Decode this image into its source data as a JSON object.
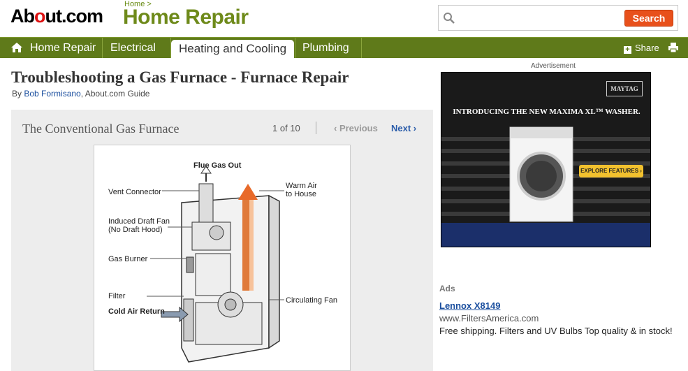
{
  "header": {
    "logo_prefix": "Ab",
    "logo_dot": "o",
    "logo_suffix": "ut.com",
    "breadcrumb": "Home",
    "breadcrumb_sep": ">",
    "site_title": "Home Repair",
    "search_placeholder": "",
    "search_button": "Search"
  },
  "nav": {
    "items": [
      {
        "label": "Home Repair",
        "icon": "house-icon"
      },
      {
        "label": "Electrical"
      },
      {
        "label": "Heating and Cooling",
        "active": true
      },
      {
        "label": "Plumbing"
      }
    ],
    "share_label": "Share",
    "print_icon": "printer-icon"
  },
  "article": {
    "title": "Troubleshooting a Gas Furnace - Furnace Repair",
    "by": "By",
    "author": "Bob Formisano",
    "author_suffix": ", About.com Guide"
  },
  "slideshow": {
    "title": "The Conventional Gas Furnace",
    "count": "1 of 10",
    "prev": "‹ Previous",
    "next": "Next ›"
  },
  "diagram": {
    "labels": {
      "flue": "Flue Gas Out",
      "vent": "Vent Connector",
      "warm_air_1": "Warm Air",
      "warm_air_2": "to House",
      "induced_1": "Induced Draft Fan",
      "induced_2": "(No Draft Hood)",
      "burner": "Gas Burner",
      "filter": "Filter",
      "fan": "Circulating Fan",
      "cold_air": "Cold Air Return"
    }
  },
  "sidebar": {
    "ad_label": "Advertisement",
    "ad_brand": "MAYTAG",
    "ad_headline": "INTRODUCING THE NEW MAXIMA XL™ WASHER.",
    "ad_cta": "EXPLORE FEATURES ›",
    "ads_title": "Ads",
    "ad_link": "Lennox X8149",
    "ad_url": "www.FiltersAmerica.com",
    "ad_desc": "Free shipping. Filters and UV Bulbs Top quality & in stock!"
  },
  "colors": {
    "nav_green": "#5f7a1a",
    "title_green": "#6e8a1a",
    "search_orange": "#e8501b",
    "link_blue": "#1a4e9e"
  }
}
